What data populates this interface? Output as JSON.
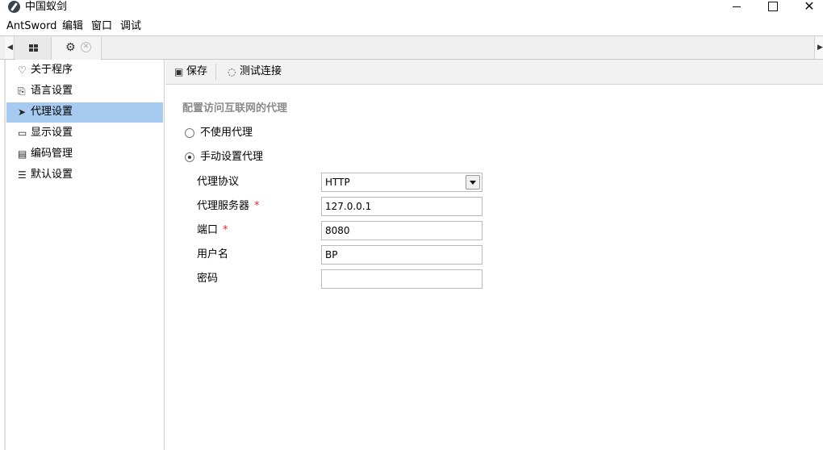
{
  "window": {
    "title": "中国蚁剑",
    "controls": {
      "minimize": "",
      "maximize": "",
      "close": "✕"
    }
  },
  "menubar": [
    "AntSword",
    "编辑",
    "窗口",
    "调试"
  ],
  "tabs": {
    "left_arrow": "◀",
    "right_arrow": "▶",
    "items": [
      {
        "icon": "grid-icon"
      },
      {
        "icon": "gear-icon",
        "close": "✕"
      }
    ]
  },
  "sidebar": {
    "items": [
      {
        "icon": "heart-icon",
        "glyph": "♡",
        "label": "关于程序",
        "active": false
      },
      {
        "icon": "language-icon",
        "glyph": "⎘",
        "label": "语言设置",
        "active": false
      },
      {
        "icon": "paper-plane-icon",
        "glyph": "➤",
        "label": "代理设置",
        "active": true
      },
      {
        "icon": "monitor-icon",
        "glyph": "▭",
        "label": "显示设置",
        "active": false
      },
      {
        "icon": "file-code-icon",
        "glyph": "▤",
        "label": "编码管理",
        "active": false
      },
      {
        "icon": "sliders-icon",
        "glyph": "☰",
        "label": "默认设置",
        "active": false
      }
    ]
  },
  "toolbar": {
    "save": {
      "icon": "floppy-icon",
      "glyph": "▣",
      "label": "保存"
    },
    "test": {
      "icon": "spinner-icon",
      "glyph": "◌",
      "label": "测试连接"
    }
  },
  "proxy": {
    "section_title": "配置访问互联网的代理",
    "options": [
      {
        "label": "不使用代理",
        "checked": false
      },
      {
        "label": "手动设置代理",
        "checked": true
      }
    ],
    "fields": {
      "protocol": {
        "label": "代理协议",
        "value": "HTTP",
        "required": false
      },
      "server": {
        "label": "代理服务器",
        "value": "127.0.0.1",
        "required": true
      },
      "port": {
        "label": "端口",
        "value": "8080",
        "required": true
      },
      "username": {
        "label": "用户名",
        "value": "BP",
        "required": false
      },
      "password": {
        "label": "密码",
        "value": "",
        "required": false
      }
    },
    "required_mark": "*"
  },
  "colors": {
    "active_item": "#a6caf0",
    "required": "#e23",
    "section_title": "#8a8a8a"
  }
}
